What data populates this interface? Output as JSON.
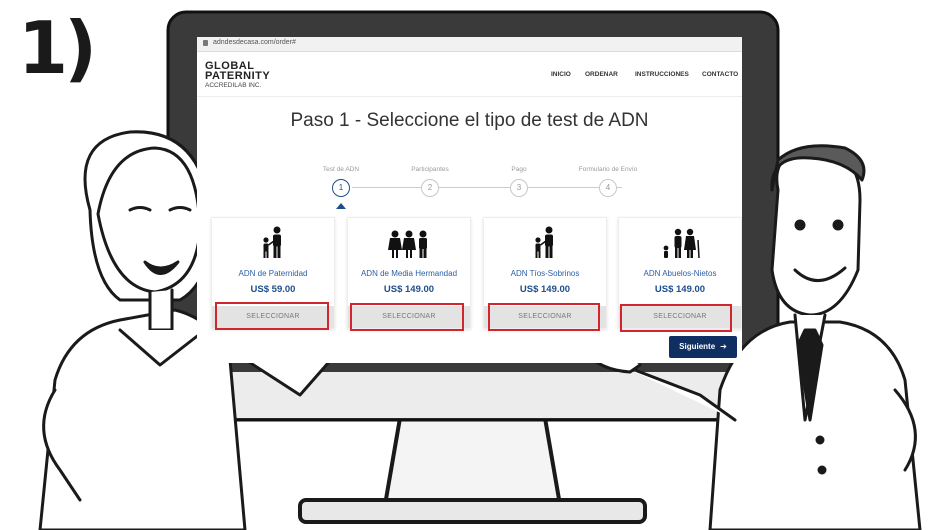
{
  "step_marker": "1)",
  "browser": {
    "url": "adndesdecasa.com/order#"
  },
  "site": {
    "logo_line1": "GLOBAL",
    "logo_line2": "PATERNITY",
    "logo_line3": "ACCREDILAB INC.",
    "nav": [
      "INICIO",
      "ORDENAR",
      "INSTRUCCIONES",
      "CONTACTO"
    ]
  },
  "page_title": "Paso 1 - Seleccione el tipo de test de ADN",
  "steps": [
    {
      "label": "Test de ADN",
      "number": "1",
      "active": true
    },
    {
      "label": "Participantes",
      "number": "2",
      "active": false
    },
    {
      "label": "Pago",
      "number": "3",
      "active": false
    },
    {
      "label": "Formulario de Envío",
      "number": "4",
      "active": false
    }
  ],
  "products": [
    {
      "name": "ADN de Paternidad",
      "price": "US$ 59.00",
      "button": "SELECCIONAR",
      "icon": "father-child-icon"
    },
    {
      "name": "ADN de Media Hermandad",
      "price": "US$ 149.00",
      "button": "SELECCIONAR",
      "icon": "siblings-icon"
    },
    {
      "name": "ADN Tíos-Sobrinos",
      "price": "US$ 149.00",
      "button": "SELECCIONAR",
      "icon": "uncle-nephew-icon"
    },
    {
      "name": "ADN Abuelos-Nietos",
      "price": "US$ 149.00",
      "button": "SELECCIONAR",
      "icon": "grandparents-icon"
    }
  ],
  "next_button": "Siguiente",
  "colors": {
    "primary": "#0f2f63",
    "link": "#2b5ea8",
    "highlight": "#d0262d"
  }
}
